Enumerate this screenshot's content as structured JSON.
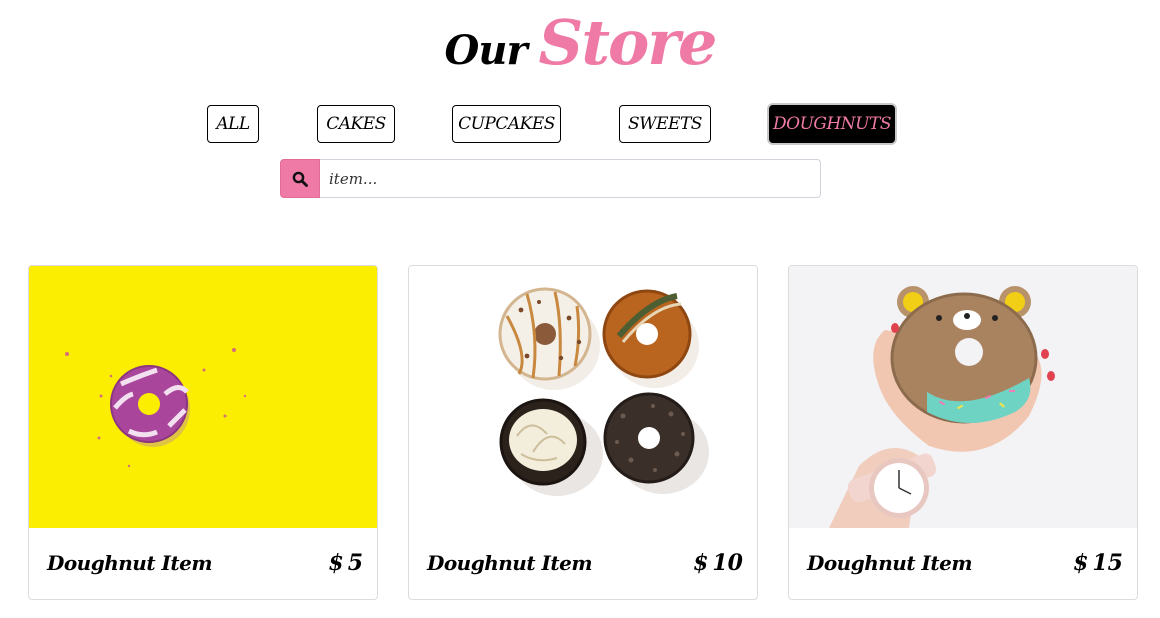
{
  "header": {
    "title_prefix": "Our",
    "title_main": "Store"
  },
  "filters": [
    {
      "label": "ALL",
      "active": false
    },
    {
      "label": "CAKES",
      "active": false
    },
    {
      "label": "CUPCAKES",
      "active": false
    },
    {
      "label": "SWEETS",
      "active": false
    },
    {
      "label": "DOUGHNUTS",
      "active": true
    }
  ],
  "search": {
    "placeholder": "item...",
    "icon": "search-icon"
  },
  "products": [
    {
      "name": "Doughnut Item",
      "currency": "$",
      "price": "5",
      "image": "pink-doughnut-on-yellow"
    },
    {
      "name": "Doughnut Item",
      "currency": "$",
      "price": "10",
      "image": "four-doughnuts-on-white"
    },
    {
      "name": "Doughnut Item",
      "currency": "$",
      "price": "15",
      "image": "bear-doughnut-in-hand"
    }
  ],
  "colors": {
    "accent": "#ef7aa6",
    "active_bg": "#000000"
  }
}
